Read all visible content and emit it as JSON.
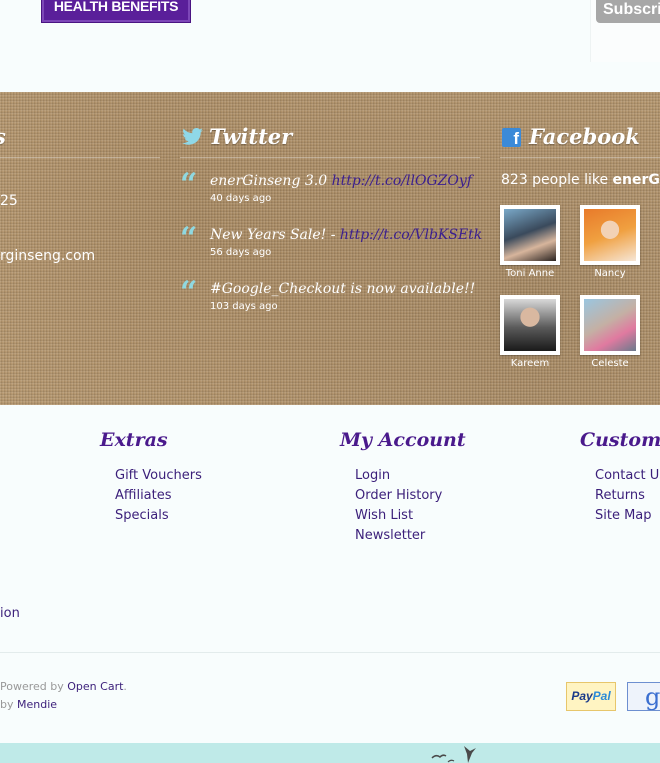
{
  "header": {
    "badge": "HEALTH BENEFITS",
    "subscribe_label": "Subscribe"
  },
  "contact": {
    "title_fragment": "s",
    "phone_fragment": "25",
    "email_fragment": "rginseng.com"
  },
  "twitter": {
    "title": "Twitter",
    "tweets": [
      {
        "text": "enerGinseng 3.0 ",
        "link": "http://t.co/llOGZOyf",
        "time": "40 days ago"
      },
      {
        "text": "New Years Sale! - ",
        "link": "http://t.co/VlbKSEtk",
        "time": "56 days ago"
      },
      {
        "text": "#Google_Checkout is now available!!",
        "link": "",
        "time": "103 days ago"
      }
    ]
  },
  "facebook": {
    "title": "Facebook",
    "like_count_text": "823 people like ",
    "page_name_fragment": "enerG",
    "friends": [
      {
        "name": "Toni Anne"
      },
      {
        "name": "Nancy"
      },
      {
        "name": "Kareem"
      },
      {
        "name": "Celeste"
      }
    ]
  },
  "footer": {
    "extras": {
      "title": "Extras",
      "links": [
        "Gift Vouchers",
        "Affiliates",
        "Specials"
      ]
    },
    "account": {
      "title": "My Account",
      "links": [
        "Login",
        "Order History",
        "Wish List",
        "Newsletter"
      ]
    },
    "customer": {
      "title": "Custome",
      "links": [
        "Contact Us",
        "Returns",
        "Site Map"
      ]
    },
    "info_fragment": "ion",
    "powered_prefix": "Powered by ",
    "powered_link": "Open Cart",
    "powered_suffix": ".",
    "by_prefix": "by ",
    "by_link": "Mendie",
    "paypal_a": "Pay",
    "paypal_b": "Pal",
    "google_glyph": "g"
  }
}
